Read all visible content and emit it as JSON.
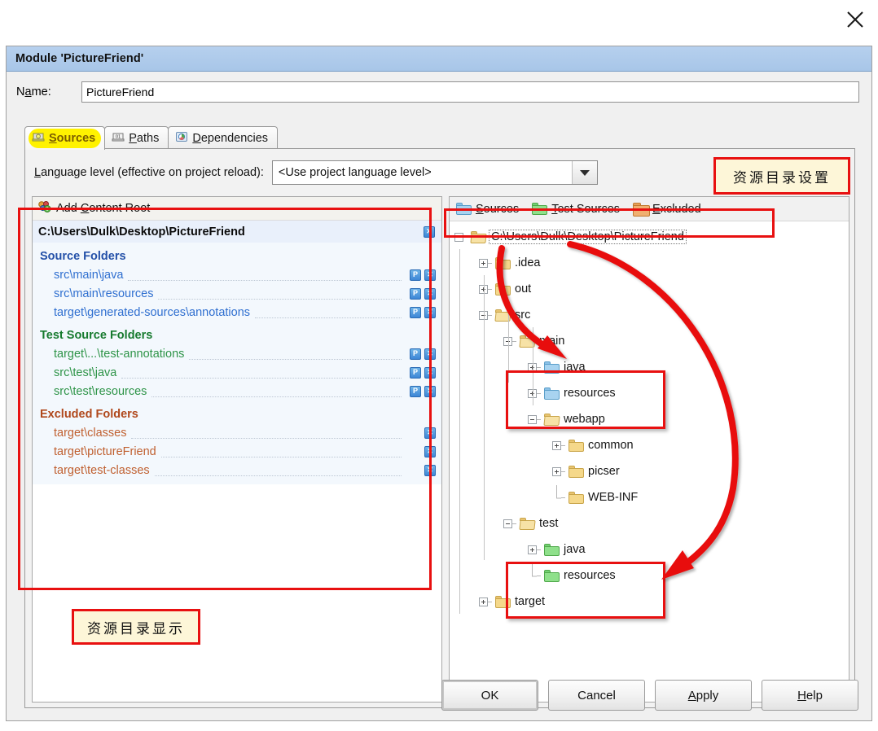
{
  "window": {
    "close_icon": "close-icon"
  },
  "dialog": {
    "title": "Module 'PictureFriend'",
    "name_label_pre": "N",
    "name_label_mid": "a",
    "name_label_post": "me:",
    "name_value": "PictureFriend",
    "tabs": [
      {
        "label_pre": "S",
        "label_post": "ources",
        "icon": "sources-icon",
        "selected": true,
        "name": "tab-sources"
      },
      {
        "label_pre": "P",
        "label_post": "aths",
        "icon": "paths-icon",
        "selected": false,
        "name": "tab-paths"
      },
      {
        "label_pre": "D",
        "label_post": "ependencies",
        "icon": "dependencies-icon",
        "selected": false,
        "name": "tab-dependencies"
      }
    ]
  },
  "language_level": {
    "label_pre": "L",
    "label_post": "anguage level (effective on project reload):",
    "value": "<Use project language level>",
    "caret_icon": "chevron-down-icon"
  },
  "left_pane": {
    "add_content_root": {
      "pre": "Add ",
      "accel": "C",
      "post": "ontent Root",
      "icon": "add-content-root-icon"
    },
    "root_path": "C:\\Users\\Dulk\\Desktop\\PictureFriend",
    "root_remove_icon": "remove-icon",
    "sections": [
      {
        "title": "Source Folders",
        "kind": "src",
        "color": "#2350a8",
        "items": [
          {
            "path": "src\\main\\java",
            "has_package_btn": true,
            "package_btn_label": "P",
            "remove_icon": "remove-icon"
          },
          {
            "path": "src\\main\\resources",
            "has_package_btn": true,
            "package_btn_label": "P",
            "remove_icon": "remove-icon"
          },
          {
            "path": "target\\generated-sources\\annotations",
            "has_package_btn": true,
            "package_btn_label": "P",
            "remove_icon": "remove-icon"
          }
        ]
      },
      {
        "title": "Test Source Folders",
        "kind": "test",
        "color": "#167a2e",
        "items": [
          {
            "path": "target\\...\\test-annotations",
            "has_package_btn": true,
            "package_btn_label": "P",
            "remove_icon": "remove-icon"
          },
          {
            "path": "src\\test\\java",
            "has_package_btn": true,
            "package_btn_label": "P",
            "remove_icon": "remove-icon"
          },
          {
            "path": "src\\test\\resources",
            "has_package_btn": true,
            "package_btn_label": "P",
            "remove_icon": "remove-icon"
          }
        ]
      },
      {
        "title": "Excluded Folders",
        "kind": "excl",
        "color": "#b0481c",
        "items": [
          {
            "path": "target\\classes",
            "has_package_btn": false,
            "remove_icon": "remove-icon"
          },
          {
            "path": "target\\pictureFriend",
            "has_package_btn": false,
            "remove_icon": "remove-icon"
          },
          {
            "path": "target\\test-classes",
            "has_package_btn": false,
            "remove_icon": "remove-icon"
          }
        ]
      }
    ]
  },
  "right_pane": {
    "toolbar": [
      {
        "pre": "",
        "accel": "S",
        "post": "ources",
        "folder_color": "blue",
        "name": "mark-sources-button"
      },
      {
        "pre": "",
        "accel": "T",
        "post": "est Sources",
        "folder_color": "green",
        "name": "mark-test-sources-button"
      },
      {
        "pre": "",
        "accel": "E",
        "post": "xcluded",
        "folder_color": "orange",
        "name": "mark-excluded-button"
      }
    ],
    "tree": [
      {
        "label": "C:\\Users\\Dulk\\Desktop\\PictureFriend",
        "depth": 0,
        "state": "minus",
        "folder": "open",
        "root": true
      },
      {
        "label": ".idea",
        "depth": 1,
        "state": "plus",
        "folder": "yellow"
      },
      {
        "label": "out",
        "depth": 1,
        "state": "plus",
        "folder": "yellow"
      },
      {
        "label": "src",
        "depth": 1,
        "state": "minus",
        "folder": "open"
      },
      {
        "label": "main",
        "depth": 2,
        "state": "minus",
        "folder": "open"
      },
      {
        "label": "java",
        "depth": 3,
        "state": "plus",
        "folder": "blue"
      },
      {
        "label": "resources",
        "depth": 3,
        "state": "plus",
        "folder": "blue"
      },
      {
        "label": "webapp",
        "depth": 3,
        "state": "minus",
        "folder": "open"
      },
      {
        "label": "common",
        "depth": 4,
        "state": "plus",
        "folder": "yellow"
      },
      {
        "label": "picser",
        "depth": 4,
        "state": "plus",
        "folder": "yellow"
      },
      {
        "label": "WEB-INF",
        "depth": 4,
        "state": "leaf",
        "folder": "yellow"
      },
      {
        "label": "test",
        "depth": 2,
        "state": "minus",
        "folder": "open"
      },
      {
        "label": "java",
        "depth": 3,
        "state": "plus",
        "folder": "green"
      },
      {
        "label": "resources",
        "depth": 3,
        "state": "leaf",
        "folder": "green"
      },
      {
        "label": "target",
        "depth": 1,
        "state": "plus",
        "folder": "yellow"
      }
    ]
  },
  "buttons": [
    {
      "label_pre": "OK",
      "label_accel": "",
      "label_post": "",
      "default": true,
      "name": "ok-button"
    },
    {
      "label_pre": "Cancel",
      "label_accel": "",
      "label_post": "",
      "default": false,
      "name": "cancel-button"
    },
    {
      "label_pre": "",
      "label_accel": "A",
      "label_post": "pply",
      "default": false,
      "name": "apply-button"
    },
    {
      "label_pre": "",
      "label_accel": "H",
      "label_post": "elp",
      "default": false,
      "name": "help-button"
    }
  ],
  "annotations": [
    {
      "text": "资源目录设置",
      "name": "annotation-resource-dir-settings"
    },
    {
      "text": "资源目录显示",
      "name": "annotation-resource-dir-display"
    }
  ],
  "colors": {
    "annotation_border": "#e81010",
    "annotation_bg": "#fdf6d8",
    "titlebar": "#b6d0ee",
    "tab_highlight": "#fff200"
  }
}
